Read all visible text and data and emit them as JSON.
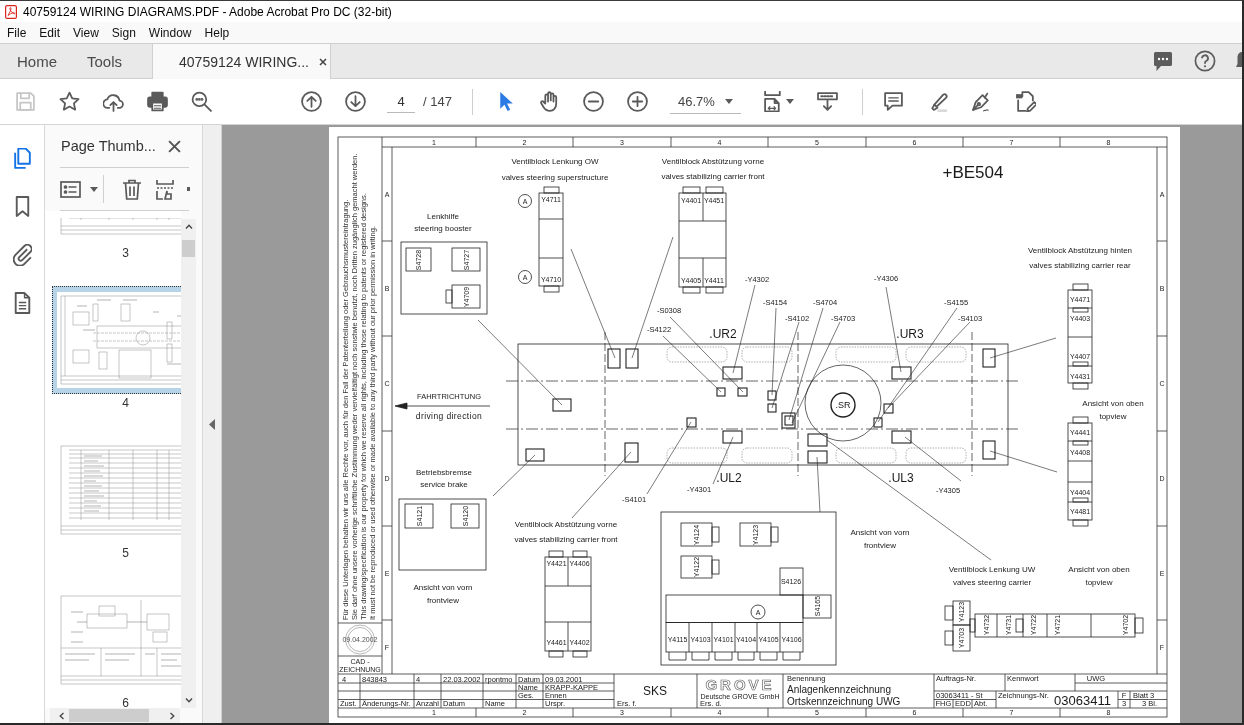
{
  "window": {
    "title": "40759124 WIRING DIAGRAMS.PDF - Adobe Acrobat Pro DC (32-bit)"
  },
  "menu": [
    "File",
    "Edit",
    "View",
    "Sign",
    "Window",
    "Help"
  ],
  "tabs": [
    {
      "label": "Home",
      "kind": "nav",
      "selected": false
    },
    {
      "label": "Tools",
      "kind": "nav",
      "selected": false
    },
    {
      "label": "40759124 WIRING...",
      "kind": "document",
      "selected": true
    }
  ],
  "toolbar": {
    "file_tools": [
      {
        "kind": "save",
        "disabled": true
      },
      {
        "kind": "star",
        "disabled": false
      },
      {
        "kind": "upload",
        "disabled": false
      },
      {
        "kind": "print",
        "disabled": false
      },
      {
        "kind": "find",
        "disabled": false
      }
    ],
    "page_buttons": [
      {
        "kind": "up"
      },
      {
        "kind": "down"
      }
    ],
    "page_field": {
      "value": "4"
    },
    "page_count": "/ 147",
    "pointer_tools": [
      {
        "kind": "select",
        "selected": true
      },
      {
        "kind": "hand",
        "selected": false
      }
    ],
    "zoom_buttons": [
      {
        "kind": "minus"
      },
      {
        "kind": "plus"
      }
    ],
    "zoom_field": {
      "value": "46.7%"
    },
    "view_tools": [
      {
        "kind": "fit"
      },
      {
        "kind": "scroll"
      }
    ],
    "annotate_tools": [
      {
        "kind": "comment"
      },
      {
        "kind": "highlight"
      },
      {
        "kind": "sign"
      },
      {
        "kind": "edit"
      }
    ]
  },
  "side_rail": [
    {
      "kind": "pages",
      "selected": true
    },
    {
      "kind": "bookmarks",
      "selected": false
    },
    {
      "kind": "attachments",
      "selected": false
    },
    {
      "kind": "document",
      "selected": false
    }
  ],
  "thumbnails_panel": {
    "title": "Page Thumb...",
    "thumbnails": [
      {
        "label": "3",
        "kind": "table",
        "selected": false
      },
      {
        "label": "4",
        "kind": "diagram",
        "selected": true
      },
      {
        "label": "5",
        "kind": "table",
        "selected": false
      },
      {
        "label": "6",
        "kind": "drawing",
        "selected": false
      }
    ]
  },
  "page": {
    "column_numbers": [
      "1",
      "2",
      "3",
      "4",
      "5",
      "6",
      "7",
      "8"
    ],
    "row_letters_left": [
      "A",
      "B",
      "C",
      "D",
      "E",
      "F"
    ],
    "row_letters_right": [
      "A",
      "B",
      "C",
      "D",
      "E",
      "F"
    ],
    "copyright_note": [
      "Für diese Unterlagen behalten wir uns alle Rechte vor, auch für den Fall der Patenterteilung oder Gebrauchsmustereintragung.",
      "Sie darf ohne unsere vorherige schriftliche Zustimmung weder vervielfältigt noch sonstwie benutzt, noch Dritten zugänglich gemacht werden.",
      "This drawing/specification is our property for which we reserve all rights, including those relating to patents or registered designs.",
      "It must not be reproduced or used otherwise or made available to any third party without our prior permission in writing."
    ],
    "cad_stamp": {
      "date": "09.04.2002",
      "label": [
        "CAD -",
        "ZEICHNUNG"
      ]
    },
    "sheet_id": "+BE504",
    "captions": [
      {
        "title": "Ventilblock Lenkung OW",
        "subtitle": "valves steering superstructure"
      },
      {
        "title": "Ventilblock Abstützung vorne",
        "subtitle": "valves stabilizing carrier front"
      },
      {
        "title": "Lenkhilfe",
        "subtitle": "steering booster"
      },
      {
        "title": "Ventilblock Abstützung hinten",
        "subtitle": "valves stabilizing carrier rear"
      },
      {
        "title": "Ansicht von oben",
        "subtitle": "topview"
      },
      {
        "title": "Betriebsbremse",
        "subtitle": "service brake"
      },
      {
        "title": "Ventilblock Abstützung vorne",
        "subtitle": "valves stabilizing carrier front"
      },
      {
        "title": "Ansicht von vorn",
        "subtitle": "frontview"
      },
      {
        "title": "Ventilblock Lenkung UW",
        "subtitle": "valves steering carrier"
      },
      {
        "title": "Ansicht von oben",
        "subtitle": "topview"
      },
      {
        "title": "Ansicht von vorn",
        "subtitle": "frontview"
      }
    ],
    "direction": {
      "label": "FAHRTRICHTUNG",
      "sublabel": "driving direction"
    },
    "component_tags": [
      "S4728",
      "S4727",
      "Y4709",
      "Y4711",
      "Y4710",
      "Y4401",
      "Y4451",
      "Y4405",
      "Y4411",
      "Y4471",
      "Y4403",
      "Y4407",
      "Y4431",
      "Y4441",
      "Y4408",
      "Y4404",
      "Y4481",
      "S4121",
      "S4120",
      "Y4421",
      "Y4406",
      "Y4461",
      "Y4402",
      "Y4124",
      "Y4123",
      "Y4122",
      "S4126",
      "S4165",
      "Y4115",
      "Y4103",
      "Y4101",
      "Y4104",
      "Y4105",
      "Y4106",
      "Y4123",
      "Y4703",
      "Y4732",
      "Y4731",
      "Y4722",
      "Y4721",
      "Y4702"
    ],
    "detail_markers": [
      "A",
      "A",
      "A"
    ],
    "callouts": [
      "-Y4302",
      "-Y4306",
      "-S4154",
      "-S4704",
      "-S4155",
      "-S0308",
      "-S4102",
      "-S4703",
      "-S4103",
      "-S4122",
      "-Y4301",
      "-Y4305",
      "-S4101"
    ],
    "zones": [
      ".UR2",
      ".UR3",
      ".UL2",
      ".UL3",
      ".SR"
    ],
    "title_block": [
      "4",
      "843843",
      "4",
      "22.03.2002",
      "rpontmo",
      "Datum",
      "09.03.2001",
      "Name",
      "KRAPP-KAPPE",
      "Ges.",
      "Ennen",
      "Zust.",
      "Änderungs-Nr.",
      "Anzahl",
      "Datum",
      "Name",
      "Urspr.",
      "SKS",
      "Ers. f.",
      "Deutsche GROVE GmbH",
      "Ers. d.",
      "Benennung",
      "Anlagenkennzeichnung",
      "Ortskennzeichnung UWG",
      "Auftrags-Nr.",
      "Kennwort",
      "UWG",
      "03063411 - St",
      "Zeichnungs-Nr.",
      "03063411",
      "F",
      "Blatt 3",
      "FHG",
      "EDD",
      "Abt.",
      "3",
      "3 Bl."
    ],
    "logo": "GROVE",
    "footer_column_numbers": [
      "1",
      "2",
      "3",
      "4",
      "5",
      "6",
      "7",
      "8"
    ]
  }
}
